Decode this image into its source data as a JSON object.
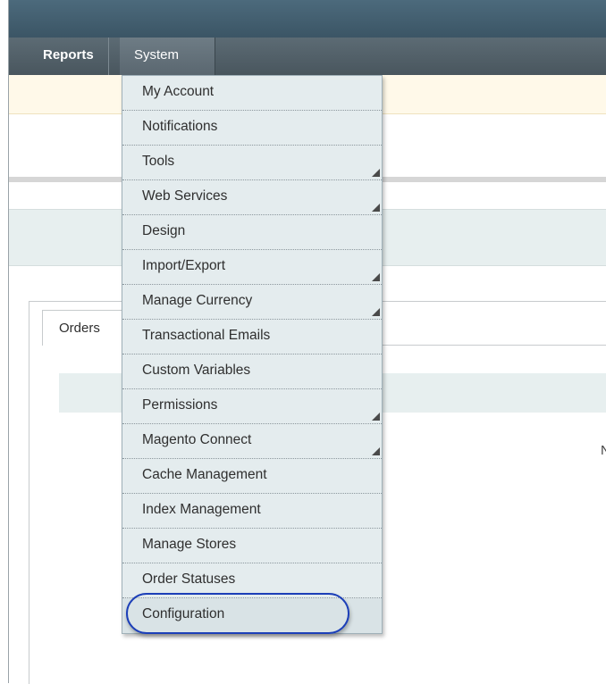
{
  "nav": {
    "tabs": [
      {
        "label": "Reports"
      },
      {
        "label": "System"
      }
    ]
  },
  "page": {
    "tab_orders": "Orders",
    "edge_glyph": "N"
  },
  "system_menu": {
    "items": [
      {
        "label": "My Account",
        "has_submenu": false
      },
      {
        "label": "Notifications",
        "has_submenu": false
      },
      {
        "label": "Tools",
        "has_submenu": true
      },
      {
        "label": "Web Services",
        "has_submenu": true
      },
      {
        "label": "Design",
        "has_submenu": false
      },
      {
        "label": "Import/Export",
        "has_submenu": true
      },
      {
        "label": "Manage Currency",
        "has_submenu": true
      },
      {
        "label": "Transactional Emails",
        "has_submenu": false
      },
      {
        "label": "Custom Variables",
        "has_submenu": false
      },
      {
        "label": "Permissions",
        "has_submenu": true
      },
      {
        "label": "Magento Connect",
        "has_submenu": true
      },
      {
        "label": "Cache Management",
        "has_submenu": false
      },
      {
        "label": "Index Management",
        "has_submenu": false
      },
      {
        "label": "Manage Stores",
        "has_submenu": false
      },
      {
        "label": "Order Statuses",
        "has_submenu": false
      },
      {
        "label": "Configuration",
        "has_submenu": false
      }
    ],
    "highlighted": "Configuration"
  },
  "colors": {
    "nav_bg": "#49565e",
    "menu_bg": "#e4ecee",
    "highlight_ring": "#1c3fb8",
    "notice_bg": "#fff9e9"
  }
}
